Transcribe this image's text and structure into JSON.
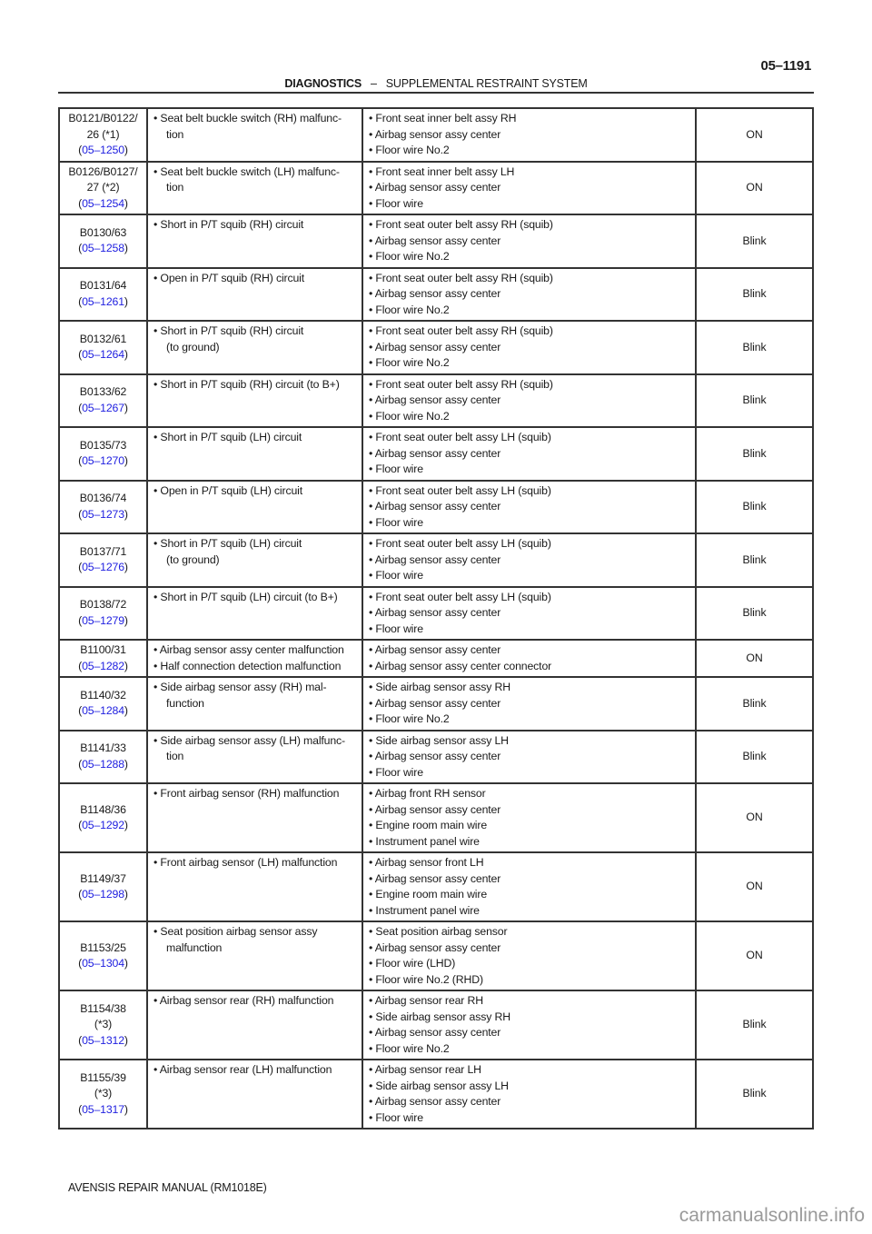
{
  "header": {
    "page_number": "05–1191",
    "section": "DIAGNOSTICS",
    "separator": "–",
    "subsection": "SUPPLEMENTAL RESTRAINT SYSTEM"
  },
  "table": {
    "rows": [
      {
        "code_lines": [
          "B0121/B0122/",
          "26 (*1)"
        ],
        "ref": "05–1250",
        "conditions": [
          {
            "text": "Seat belt buckle switch (RH) malfunc-",
            "cont": "tion"
          }
        ],
        "areas": [
          "Front seat inner belt assy RH",
          "Airbag sensor assy center",
          "Floor wire No.2"
        ],
        "lamp": "ON"
      },
      {
        "code_lines": [
          "B0126/B0127/",
          "27 (*2)"
        ],
        "ref": "05–1254",
        "conditions": [
          {
            "text": "Seat belt buckle switch (LH) malfunc-",
            "cont": "tion"
          }
        ],
        "areas": [
          "Front seat inner belt assy LH",
          "Airbag sensor assy center",
          "Floor wire"
        ],
        "lamp": "ON"
      },
      {
        "code_lines": [
          "B0130/63"
        ],
        "ref": "05–1258",
        "conditions": [
          {
            "text": "Short in P/T squib (RH) circuit",
            "cont": ""
          }
        ],
        "areas": [
          "Front seat outer belt assy RH (squib)",
          "Airbag sensor assy center",
          "Floor wire No.2"
        ],
        "lamp": "Blink"
      },
      {
        "code_lines": [
          "B0131/64"
        ],
        "ref": "05–1261",
        "conditions": [
          {
            "text": "Open in P/T squib (RH) circuit",
            "cont": ""
          }
        ],
        "areas": [
          "Front seat outer belt assy RH (squib)",
          "Airbag sensor assy center",
          "Floor wire No.2"
        ],
        "lamp": "Blink"
      },
      {
        "code_lines": [
          "B0132/61"
        ],
        "ref": "05–1264",
        "conditions": [
          {
            "text": "Short in P/T squib (RH) circuit",
            "cont": "(to ground)"
          }
        ],
        "areas": [
          "Front seat outer belt assy RH (squib)",
          "Airbag sensor assy center",
          "Floor wire No.2"
        ],
        "lamp": "Blink"
      },
      {
        "code_lines": [
          "B0133/62"
        ],
        "ref": "05–1267",
        "conditions": [
          {
            "text": "Short in P/T squib (RH) circuit (to B+)",
            "cont": ""
          }
        ],
        "areas": [
          "Front seat outer belt assy RH (squib)",
          "Airbag sensor assy center",
          "Floor wire No.2"
        ],
        "lamp": "Blink"
      },
      {
        "code_lines": [
          "B0135/73"
        ],
        "ref": "05–1270",
        "conditions": [
          {
            "text": "Short in P/T squib (LH) circuit",
            "cont": ""
          }
        ],
        "areas": [
          "Front seat outer belt assy LH (squib)",
          "Airbag sensor assy center",
          "Floor wire"
        ],
        "lamp": "Blink"
      },
      {
        "code_lines": [
          "B0136/74"
        ],
        "ref": "05–1273",
        "conditions": [
          {
            "text": "Open in P/T squib (LH) circuit",
            "cont": ""
          }
        ],
        "areas": [
          "Front seat outer belt assy LH (squib)",
          "Airbag sensor assy center",
          "Floor wire"
        ],
        "lamp": "Blink"
      },
      {
        "code_lines": [
          "B0137/71"
        ],
        "ref": "05–1276",
        "conditions": [
          {
            "text": "Short in P/T squib (LH) circuit",
            "cont": "(to ground)"
          }
        ],
        "areas": [
          "Front seat outer belt assy LH (squib)",
          "Airbag sensor assy center",
          "Floor wire"
        ],
        "lamp": "Blink"
      },
      {
        "code_lines": [
          "B0138/72"
        ],
        "ref": "05–1279",
        "conditions": [
          {
            "text": "Short in P/T squib (LH) circuit (to B+)",
            "cont": ""
          }
        ],
        "areas": [
          "Front seat outer belt assy LH (squib)",
          "Airbag sensor assy center",
          "Floor wire"
        ],
        "lamp": "Blink"
      },
      {
        "code_lines": [
          "B1100/31"
        ],
        "ref": "05–1282",
        "conditions": [
          {
            "text": "Airbag sensor assy center malfunction",
            "cont": ""
          },
          {
            "text": "Half connection detection malfunction",
            "cont": ""
          }
        ],
        "areas": [
          "Airbag sensor assy center",
          "Airbag sensor assy center connector"
        ],
        "lamp": "ON"
      },
      {
        "code_lines": [
          "B1140/32"
        ],
        "ref": "05–1284",
        "conditions": [
          {
            "text": "Side airbag sensor assy (RH) mal-",
            "cont": "function"
          }
        ],
        "areas": [
          "Side airbag sensor assy RH",
          "Airbag sensor assy center",
          "Floor wire No.2"
        ],
        "lamp": "Blink"
      },
      {
        "code_lines": [
          "B1141/33"
        ],
        "ref": "05–1288",
        "conditions": [
          {
            "text": "Side airbag sensor assy (LH) malfunc-",
            "cont": "tion"
          }
        ],
        "areas": [
          "Side airbag sensor assy LH",
          "Airbag sensor assy center",
          "Floor wire"
        ],
        "lamp": "Blink"
      },
      {
        "code_lines": [
          "B1148/36"
        ],
        "ref": "05–1292",
        "conditions": [
          {
            "text": "Front airbag sensor (RH) malfunction",
            "cont": ""
          }
        ],
        "areas": [
          "Airbag front RH sensor",
          "Airbag sensor assy center",
          "Engine room main wire",
          "Instrument panel wire"
        ],
        "lamp": "ON"
      },
      {
        "code_lines": [
          "B1149/37"
        ],
        "ref": "05–1298",
        "conditions": [
          {
            "text": "Front  airbag sensor (LH) malfunction",
            "cont": ""
          }
        ],
        "areas": [
          "Airbag sensor front LH",
          "Airbag sensor assy center",
          "Engine room main wire",
          "Instrument panel wire"
        ],
        "lamp": "ON"
      },
      {
        "code_lines": [
          "B1153/25"
        ],
        "ref": "05–1304",
        "conditions": [
          {
            "text": "Seat position airbag sensor assy",
            "cont": "malfunction"
          }
        ],
        "areas": [
          "Seat position airbag sensor",
          "Airbag sensor assy center",
          "Floor wire (LHD)",
          "Floor wire No.2 (RHD)"
        ],
        "lamp": "ON"
      },
      {
        "code_lines": [
          "B1154/38",
          "(*3)"
        ],
        "ref": "05–1312",
        "conditions": [
          {
            "text": "Airbag sensor rear (RH) malfunction",
            "cont": ""
          }
        ],
        "areas": [
          "Airbag sensor rear RH",
          "Side airbag sensor assy RH",
          "Airbag sensor assy center",
          "Floor wire No.2"
        ],
        "lamp": "Blink"
      },
      {
        "code_lines": [
          "B1155/39",
          "(*3)"
        ],
        "ref": "05–1317",
        "conditions": [
          {
            "text": "Airbag sensor rear (LH) malfunction",
            "cont": ""
          }
        ],
        "areas": [
          "Airbag sensor rear LH",
          "Side airbag sensor assy LH",
          "Airbag sensor assy center",
          "Floor wire"
        ],
        "lamp": "Blink"
      }
    ]
  },
  "footer": {
    "manual_title": "AVENSIS REPAIR MANUAL   (RM1018E)"
  },
  "watermark": "carmanualsonline.info",
  "colors": {
    "link": "#2020e0",
    "rule": "#333333",
    "watermark": "#9a9a9a"
  }
}
